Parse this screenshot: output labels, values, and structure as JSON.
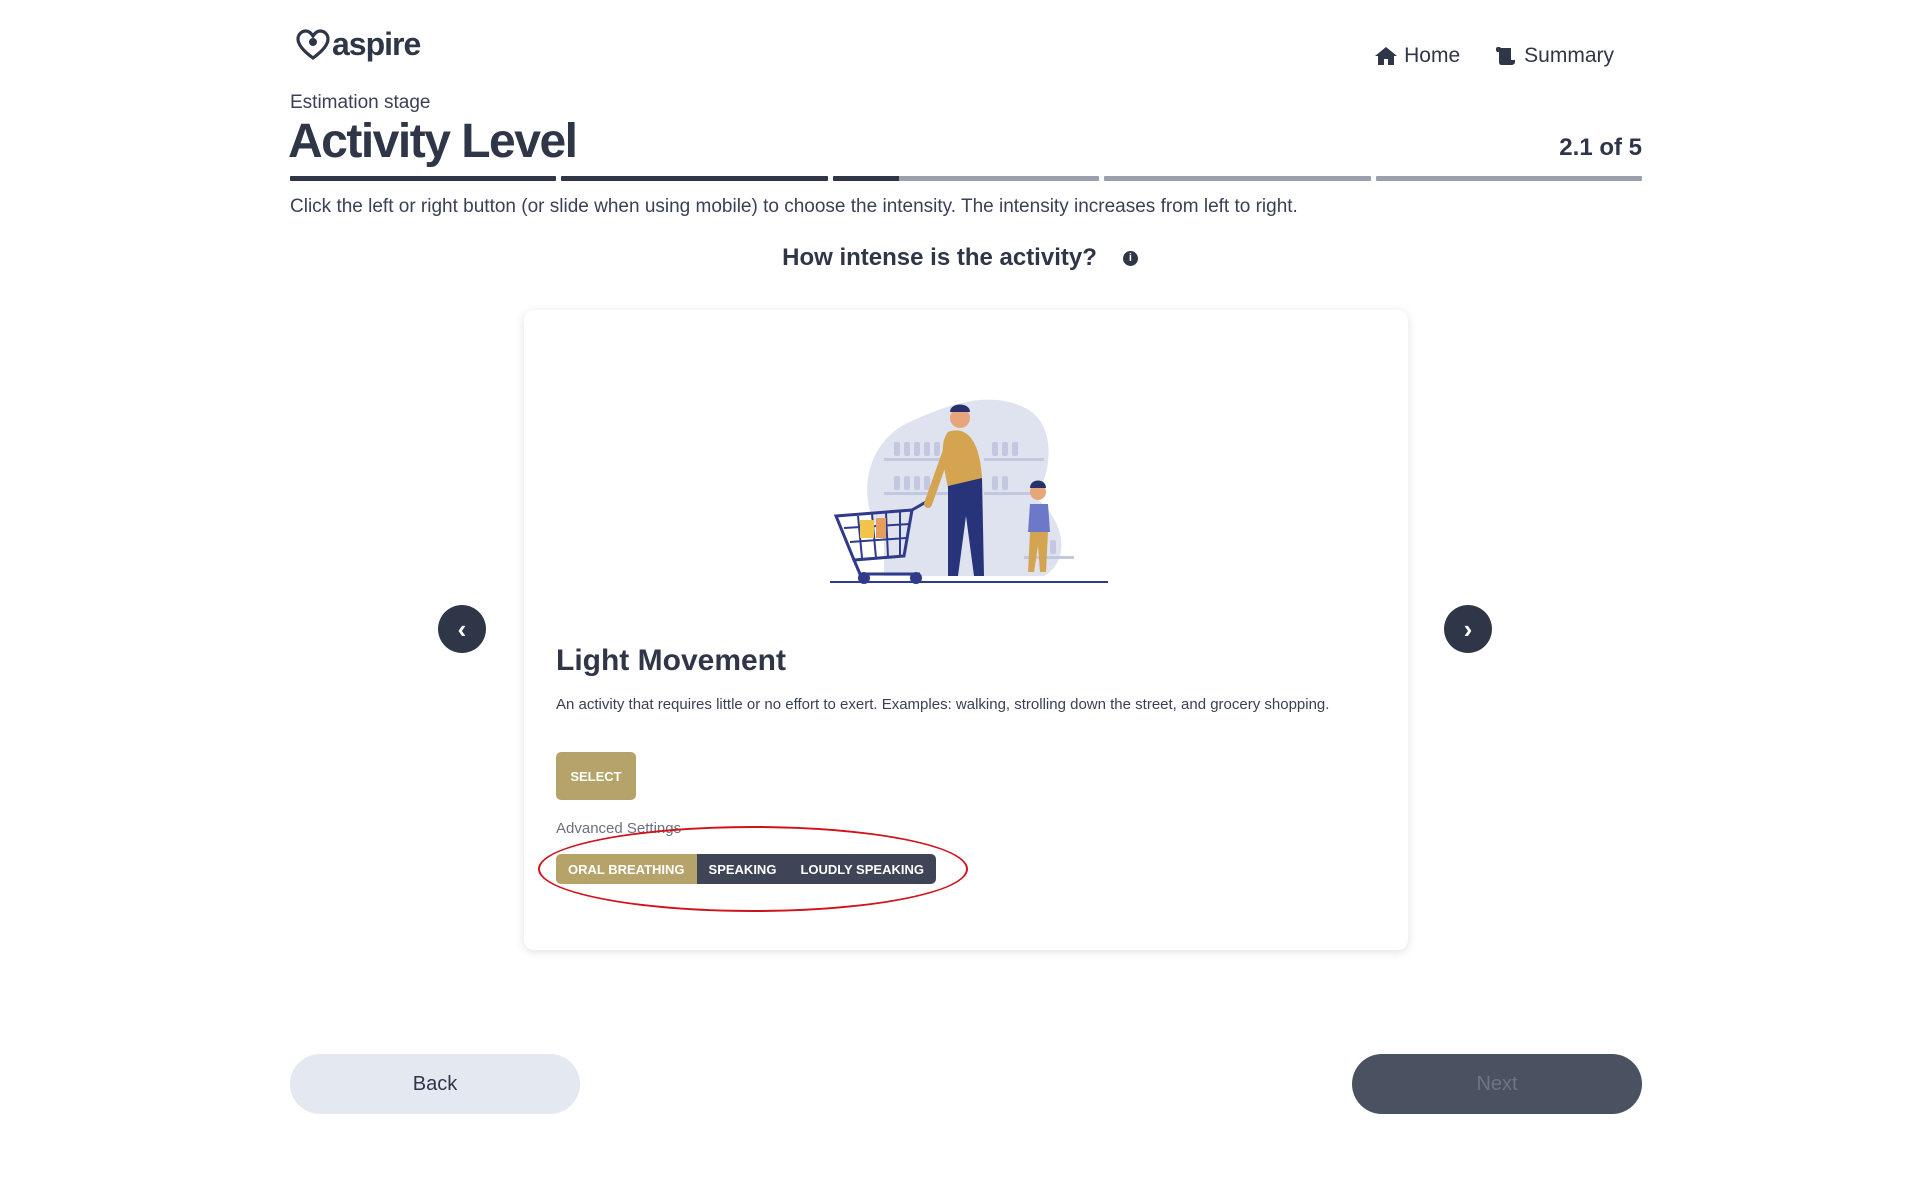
{
  "brand": {
    "name": "aspire"
  },
  "nav": {
    "home_label": "Home",
    "summary_label": "Summary"
  },
  "header": {
    "stage_label": "Estimation stage",
    "title": "Activity Level",
    "step_count": "2.1 of 5",
    "progress": {
      "segments": 5,
      "completed_fraction": 0.32,
      "segment_fills": [
        1,
        1,
        0.25,
        0,
        0
      ]
    }
  },
  "instructions": "Click the left or right button (or slide when using mobile) to choose the intensity. The intensity increases from left to right.",
  "question": {
    "text": "How intense is the activity?",
    "info_icon": "info-icon"
  },
  "card": {
    "title": "Light Movement",
    "description": "An activity that requires little or no effort to exert. Examples: walking, strolling down the street, and grocery shopping.",
    "select_label": "SELECT",
    "advanced_label": "Advanced Settings",
    "options": [
      {
        "label": "ORAL BREATHING",
        "active": true
      },
      {
        "label": "SPEAKING",
        "active": false
      },
      {
        "label": "LOUDLY SPEAKING",
        "active": false
      }
    ]
  },
  "carousel": {
    "prev_icon": "‹",
    "next_icon": "›"
  },
  "footer": {
    "back_label": "Back",
    "next_label": "Next"
  },
  "colors": {
    "primary": "#2f3648",
    "accent": "#b5a36a",
    "highlight": "#d0121b"
  }
}
